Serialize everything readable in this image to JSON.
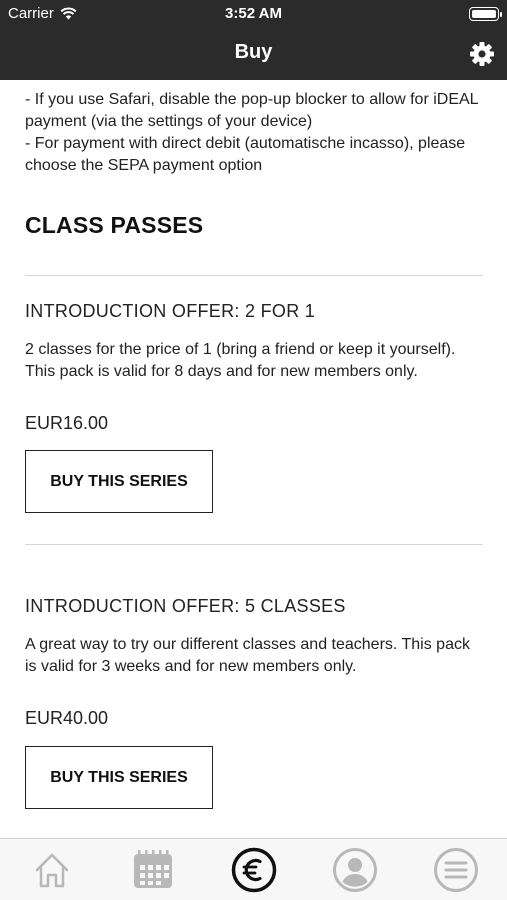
{
  "status_bar": {
    "carrier": "Carrier",
    "time": "3:52 AM"
  },
  "nav": {
    "title": "Buy",
    "settings_icon": "gear-icon"
  },
  "intro_lines": [
    "- If you use Safari, disable the pop-up blocker to allow for iDEAL payment (via the settings of your device)",
    "- For payment with direct debit (automatische incasso), please choose the SEPA payment option"
  ],
  "section_title": "CLASS PASSES",
  "passes": [
    {
      "name": "INTRODUCTION OFFER: 2 FOR 1",
      "description": "2 classes for the price of 1 (bring a friend or keep it yourself). This pack is valid for 8 days and for new members only.",
      "price": "EUR16.00",
      "button_label": "BUY THIS SERIES"
    },
    {
      "name": "INTRODUCTION OFFER: 5 CLASSES",
      "description": "A great way to try our different classes and teachers. This pack is valid for 3 weeks and for new members only.",
      "price": "EUR40.00",
      "button_label": "BUY THIS SERIES"
    }
  ],
  "tab_bar": {
    "active": "buy",
    "tabs": [
      {
        "id": "home",
        "icon": "home-icon"
      },
      {
        "id": "schedule",
        "icon": "calendar-icon"
      },
      {
        "id": "buy",
        "icon": "euro-icon"
      },
      {
        "id": "profile",
        "icon": "user-icon"
      },
      {
        "id": "menu",
        "icon": "menu-icon"
      }
    ]
  },
  "colors": {
    "header_bg": "#2b2b2b",
    "header_text": "#ffffff",
    "tab_inactive": "#b8b8b8",
    "tab_active": "#111111"
  }
}
